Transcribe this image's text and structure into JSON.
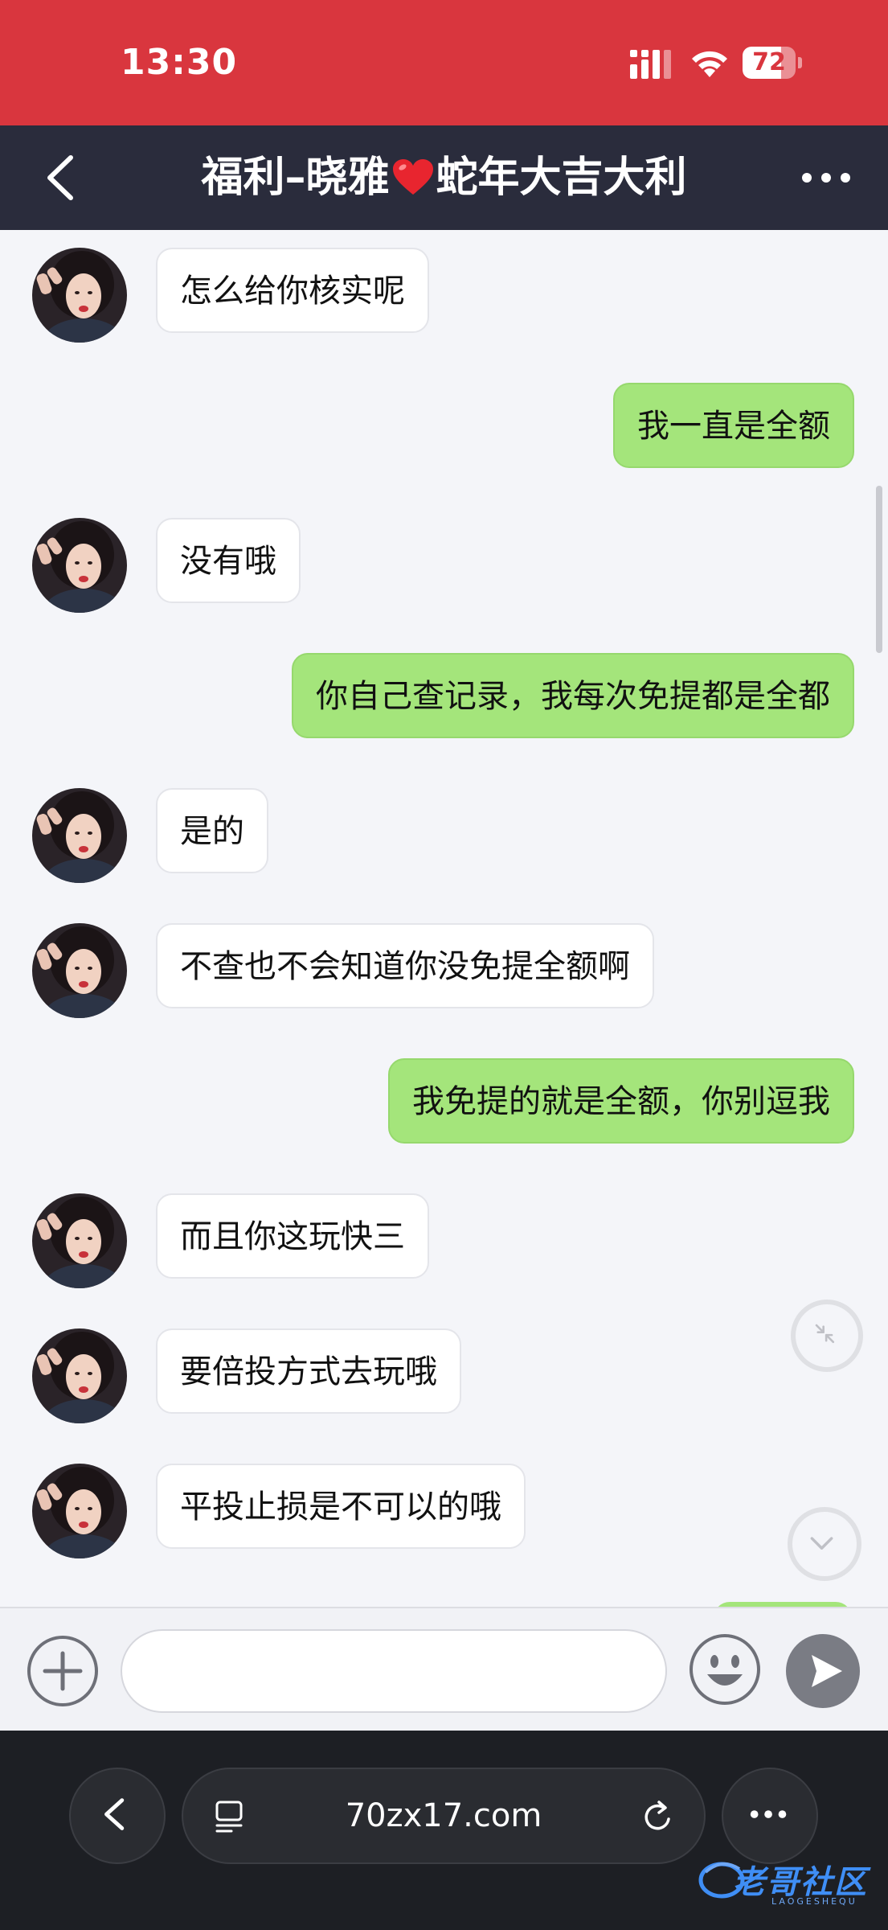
{
  "status_bar": {
    "time": "13:30",
    "battery_level": "72",
    "background_color": "#d9363e"
  },
  "header": {
    "title_before_heart": "福利–晓雅",
    "title_after_heart": "蛇年大吉大利",
    "heart_icon": "red-heart-icon",
    "background_color": "#2a2c3c"
  },
  "chat": {
    "messages": [
      {
        "side": "in",
        "text": "怎么给你核实呢"
      },
      {
        "side": "out",
        "text": "我一直是全额"
      },
      {
        "side": "in",
        "text": "没有哦"
      },
      {
        "side": "out",
        "text": "你自己查记录，我每次免提都是全都"
      },
      {
        "side": "in",
        "text": "是的"
      },
      {
        "side": "in",
        "text": "不查也不会知道你没免提全额啊"
      },
      {
        "side": "out",
        "text": "我免提的就是全额，你别逗我"
      },
      {
        "side": "in",
        "text": "而且你这玩快三"
      },
      {
        "side": "in",
        "text": "要倍投方式去玩哦"
      },
      {
        "side": "in",
        "text": "平投止损是不可以的哦"
      }
    ],
    "incoming_bubble_color": "#ffffff",
    "outgoing_bubble_color": "#a4e57b"
  },
  "input": {
    "value": "",
    "placeholder": ""
  },
  "browser": {
    "url": "70zx17.com"
  },
  "watermark": {
    "text": "老哥社区",
    "sub": "LAOGESHEQU"
  }
}
